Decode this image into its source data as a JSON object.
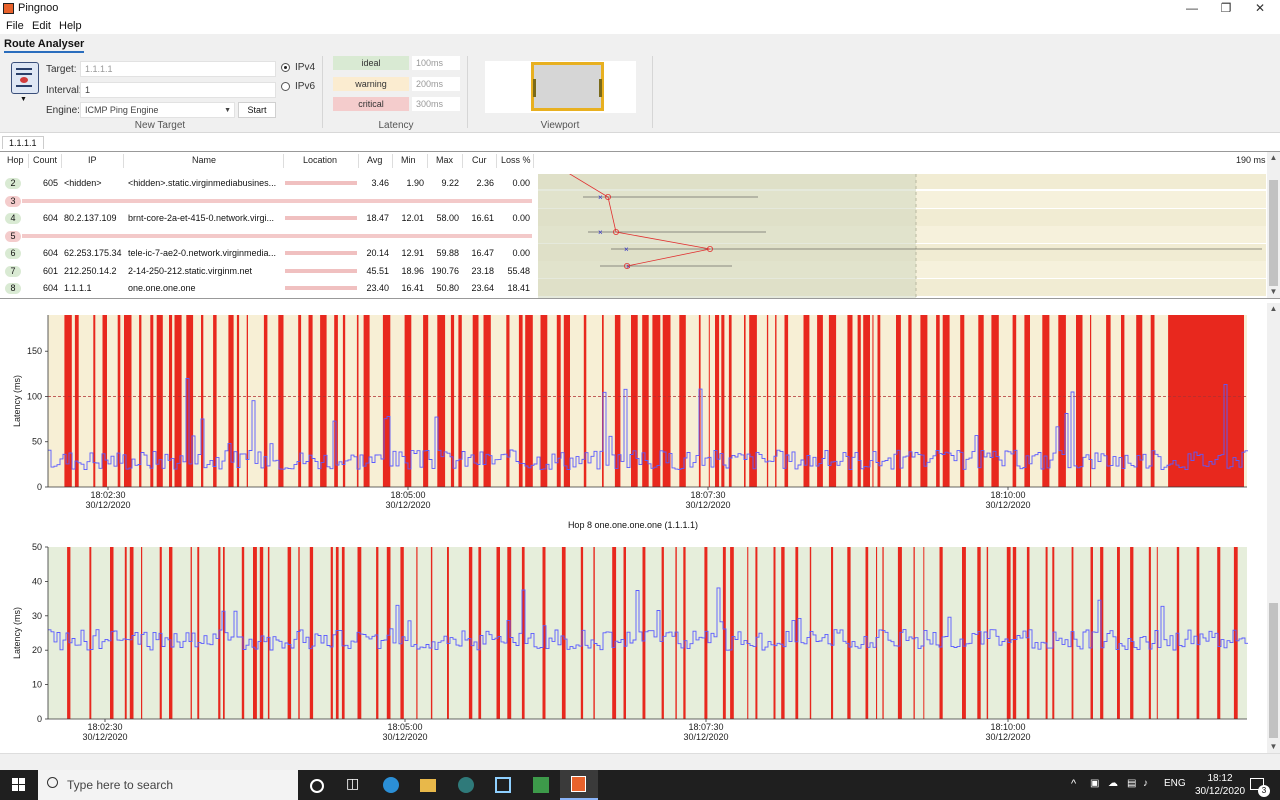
{
  "window": {
    "title": "Pingnoo"
  },
  "menu": [
    "File",
    "Edit",
    "Help"
  ],
  "ribbon": {
    "tab": "Route Analyser",
    "target_label": "Target:",
    "target_value": "1.1.1.1",
    "interval_label": "Interval:",
    "interval_value": "1",
    "engine_label": "Engine:",
    "engine_value": "ICMP Ping Engine",
    "start_label": "Start",
    "ipv4_label": "IPv4",
    "ipv6_label": "IPv6",
    "new_target_group": "New Target",
    "latency_group": "Latency",
    "viewport_group": "Viewport",
    "levels": [
      {
        "name": "ideal",
        "value": "100ms",
        "color": "#d9ead3"
      },
      {
        "name": "warning",
        "value": "200ms",
        "color": "#fbecd0"
      },
      {
        "name": "critical",
        "value": "300ms",
        "color": "#f4cccc"
      }
    ]
  },
  "tabs": [
    "1.1.1.1"
  ],
  "table": {
    "columns": [
      "Hop",
      "Count",
      "IP",
      "Name",
      "Location",
      "Avg",
      "Min",
      "Max",
      "Cur",
      "Loss %"
    ],
    "scale_label": "190 ms",
    "rows": [
      {
        "hop": "2",
        "count": "605",
        "ip": "<hidden>",
        "name": "<hidden>.static.virginmediabusines...",
        "avg": "3.46",
        "min": "1.90",
        "max": "9.22",
        "cur": "2.36",
        "loss": "0.00",
        "color": "#d9ead3"
      },
      {
        "hop": "3",
        "empty": true,
        "color": "#f4cccc"
      },
      {
        "hop": "4",
        "count": "604",
        "ip": "80.2.137.109",
        "name": "brnt-core-2a-et-415-0.network.virgi...",
        "avg": "18.47",
        "min": "12.01",
        "max": "58.00",
        "cur": "16.61",
        "loss": "0.00",
        "color": "#d9ead3"
      },
      {
        "hop": "5",
        "empty": true,
        "color": "#f4cccc"
      },
      {
        "hop": "6",
        "count": "604",
        "ip": "62.253.175.34",
        "name": "tele-ic-7-ae2-0.network.virginmedia...",
        "avg": "20.14",
        "min": "12.91",
        "max": "59.88",
        "cur": "16.47",
        "loss": "0.00",
        "color": "#d9ead3"
      },
      {
        "hop": "7",
        "count": "601",
        "ip": "212.250.14.2",
        "name": "2-14-250-212.static.virginm.net",
        "avg": "45.51",
        "min": "18.96",
        "max": "190.76",
        "cur": "23.18",
        "loss": "55.48",
        "color": "#d9ead3"
      },
      {
        "hop": "8",
        "count": "604",
        "ip": "1.1.1.1",
        "name": "one.one.one.one",
        "avg": "23.40",
        "min": "16.41",
        "max": "50.80",
        "cur": "23.64",
        "loss": "18.41",
        "color": "#d9ead3"
      }
    ]
  },
  "chart_data": [
    {
      "type": "line",
      "title": "",
      "ylabel": "Latency (ms)",
      "ylim": [
        0,
        190
      ],
      "yticks": [
        0,
        50,
        100,
        150
      ],
      "x_ticks": [
        {
          "time": "18:02:30",
          "date": "30/12/2020"
        },
        {
          "time": "18:05:00",
          "date": "30/12/2020"
        },
        {
          "time": "18:07:30",
          "date": "30/12/2020"
        },
        {
          "time": "18:10:00",
          "date": "30/12/2020"
        }
      ],
      "threshold_line": 100,
      "series_color": "#5a5aff",
      "loss_color": "#e8281e",
      "background": "#f7efd5"
    },
    {
      "type": "line",
      "title": "Hop 8 one.one.one.one (1.1.1.1)",
      "ylabel": "Latency (ms)",
      "ylim": [
        0,
        50
      ],
      "yticks": [
        0,
        10,
        20,
        30,
        40,
        50
      ],
      "x_ticks": [
        {
          "time": "18:02:30",
          "date": "30/12/2020"
        },
        {
          "time": "18:05:00",
          "date": "30/12/2020"
        },
        {
          "time": "18:07:30",
          "date": "30/12/2020"
        },
        {
          "time": "18:10:00",
          "date": "30/12/2020"
        }
      ],
      "series_color": "#5a5aff",
      "loss_color": "#e8281e",
      "background": "#e6eedb"
    }
  ],
  "taskbar": {
    "search_placeholder": "Type here to search",
    "lang": "ENG",
    "time": "18:12",
    "date": "30/12/2020",
    "notifications": "3"
  }
}
